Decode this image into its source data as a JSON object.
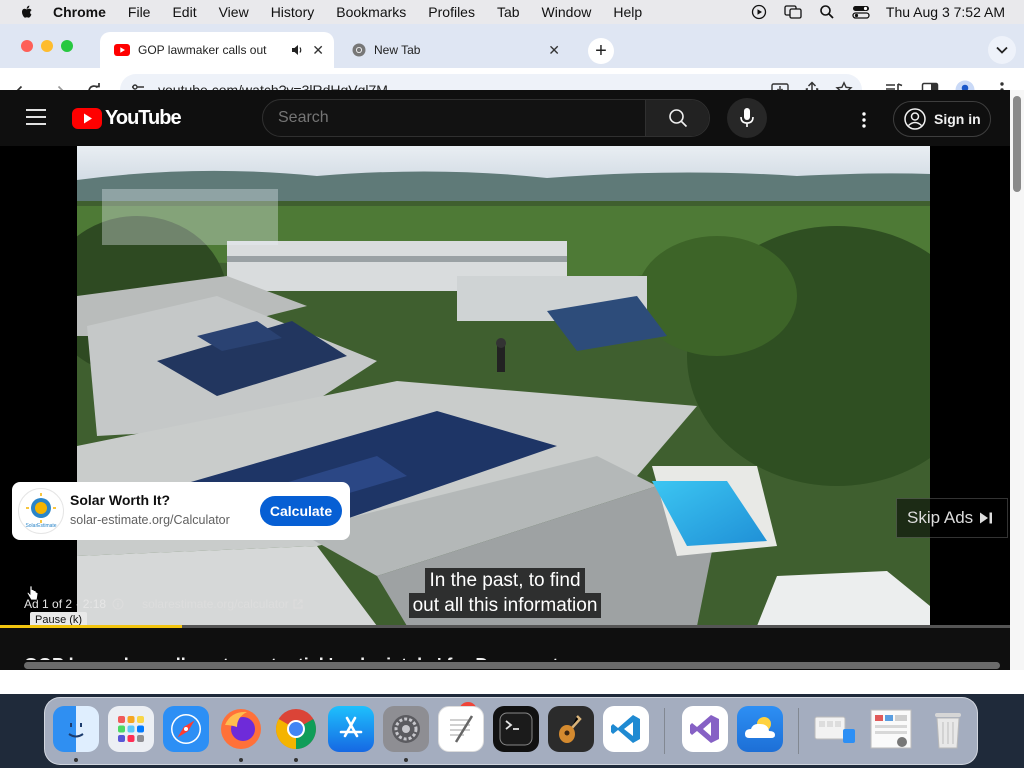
{
  "menubar": {
    "app_name": "Chrome",
    "items": [
      "File",
      "Edit",
      "View",
      "History",
      "Bookmarks",
      "Profiles",
      "Tab",
      "Window",
      "Help"
    ],
    "clock": "Thu Aug 3  7:52 AM"
  },
  "tabs": [
    {
      "title": "GOP lawmaker calls out a potential 'real mistake' for Democrats",
      "favicon": "youtube-icon",
      "audio": true
    },
    {
      "title": "New Tab",
      "favicon": "chrome-icon",
      "audio": false
    }
  ],
  "omnibox": {
    "url": "youtube.com/watch?v=3lRdHgVql7M"
  },
  "youtube": {
    "logo_text": "YouTube",
    "search_placeholder": "Search",
    "sign_in": "Sign in"
  },
  "ad": {
    "card_title": "Solar Worth It?",
    "card_url": "solar-estimate.org/Calculator",
    "cta": "Calculate",
    "badge_text": "SolarEstimate",
    "skip_label": "Skip Ads",
    "counter": "Ad 1 of 2 · 2:18",
    "display_link": "solarestimate.org/calculator",
    "progress_fraction": 0.18
  },
  "captions": [
    "In the past, to find",
    "out all this information"
  ],
  "tooltip": "Pause (k)",
  "video_title": "GOP lawmaker calls out a potential 'real mistake' for Democrats",
  "dock": {
    "apps": [
      "finder",
      "launchpad",
      "safari",
      "firefox",
      "chrome",
      "app-store",
      "system-settings",
      "textedit",
      "terminal",
      "garageband",
      "vscode",
      "visual-studio",
      "weather",
      "app-exposé",
      "preview",
      "trash"
    ],
    "settings_badge": "1"
  },
  "colors": {
    "youtube_red": "#ff0000",
    "ad_progress": "#f2c40f",
    "cta_blue": "#065fd4"
  }
}
